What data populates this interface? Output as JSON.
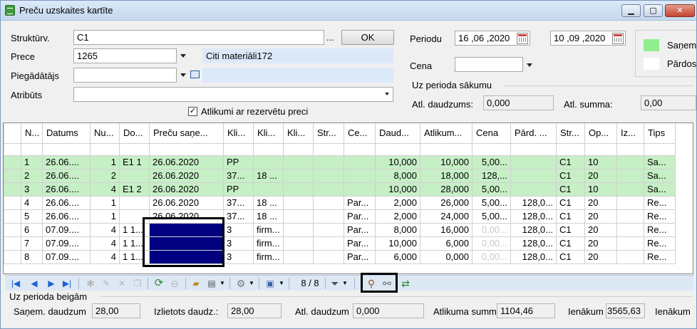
{
  "window": {
    "title": "Preču uzskaites kartīte"
  },
  "form": {
    "struktur_label": "Struktūrv.",
    "struktur_value": "C1",
    "ellipsis": "...",
    "ok_label": "OK",
    "prece_label": "Prece",
    "prece_value": "1265",
    "prece_name": "Citi materiāli172",
    "piegadatajs_label": "Piegādātājs",
    "piegadatajs_value": "",
    "atributs_label": "Atribūts",
    "atributs_value": "",
    "checkbox_label": "Atlikumi ar rezervētu preci",
    "checkbox_checked": true
  },
  "period": {
    "label": "Periodu",
    "from": "16 ,06 ,2020",
    "to": "10 ,09 ,2020",
    "cena_label": "Cena",
    "cena_value": ""
  },
  "start_period": {
    "title": "Uz perioda sākumu",
    "atl_daudzums_label": "Atl. daudzums:",
    "atl_daudzums_value": "0,000",
    "atl_summa_label": "Atl. summa:",
    "atl_summa_value": "0,00"
  },
  "legend": {
    "items": [
      {
        "label": "Saņem",
        "color": "#90ee90"
      },
      {
        "label": "Pārdos",
        "color": "#ffffff"
      }
    ]
  },
  "grid": {
    "columns": [
      "N...",
      "Datums",
      "Nu...",
      "Do...",
      "Preču saņe...",
      "Kli...",
      "Kli...",
      "Kli...",
      "Str...",
      "Ce...",
      "Daud...",
      "Atlikum...",
      "Cena",
      "Pārd. ...",
      "Str...",
      "Op...",
      "Iz...",
      "Tips"
    ],
    "rows": [
      {
        "style": "green",
        "cells": [
          "1",
          "26.06....",
          "1",
          "E1 1",
          "26.06.2020",
          "PP",
          "",
          "",
          "",
          "",
          "10,000",
          "10,000",
          "5,00...",
          "",
          "C1",
          "10",
          "",
          "Sa..."
        ]
      },
      {
        "style": "green",
        "cells": [
          "2",
          "26.06....",
          "2",
          "",
          "26.06.2020",
          "37...",
          "18 ...",
          "",
          "",
          "",
          "8,000",
          "18,000",
          "128,...",
          "",
          "C1",
          "20",
          "",
          "Sa..."
        ]
      },
      {
        "style": "green",
        "cells": [
          "3",
          "26.06....",
          "4",
          "E1 2",
          "26.06.2020",
          "PP",
          "",
          "",
          "",
          "",
          "10,000",
          "28,000",
          "5,00...",
          "",
          "C1",
          "10",
          "",
          "Sa..."
        ]
      },
      {
        "style": "white",
        "cells": [
          "4",
          "26.06....",
          "1",
          "",
          "26.06.2020",
          "37...",
          "18 ...",
          "",
          "",
          "Par...",
          "2,000",
          "26,000",
          "5,00...",
          "128,0...",
          "C1",
          "20",
          "",
          "Re..."
        ]
      },
      {
        "style": "white",
        "cells": [
          "5",
          "26.06....",
          "1",
          "",
          "26.06.2020",
          "37...",
          "18 ...",
          "",
          "",
          "Par...",
          "2,000",
          "24,000",
          "5,00...",
          "128,0...",
          "C1",
          "20",
          "",
          "Re..."
        ]
      },
      {
        "style": "white",
        "cells": [
          "6",
          "07.09....",
          "4",
          "1 1...",
          "",
          "3",
          "firm...",
          "",
          "",
          "Par...",
          "8,000",
          "16,000",
          "0,00...",
          "128,0...",
          "C1",
          "20",
          "",
          "Re..."
        ]
      },
      {
        "style": "white",
        "cells": [
          "7",
          "07.09....",
          "4",
          "1 1...",
          "",
          "3",
          "firm...",
          "",
          "",
          "Par...",
          "10,000",
          "6,000",
          "0,00...",
          "128,0...",
          "C1",
          "20",
          "",
          "Re..."
        ]
      },
      {
        "style": "white",
        "cells": [
          "8",
          "07.09....",
          "4",
          "1 1...",
          "",
          "3",
          "firm...",
          "",
          "",
          "Par...",
          "6,000",
          "0,000",
          "0,00...",
          "128,0...",
          "C1",
          "20",
          "",
          "Re..."
        ]
      }
    ]
  },
  "toolbar": {
    "record_count": "8 / 8",
    "icons": [
      "first-icon",
      "prev-icon",
      "next-icon",
      "last-icon",
      "add-icon",
      "edit-icon",
      "delete-icon",
      "copy-icon",
      "refresh-icon",
      "cancel-icon",
      "open-icon",
      "print-icon",
      "settings-icon",
      "save-icon",
      "filter-icon",
      "link-icon",
      "unlink-icon",
      "transfer-icon"
    ]
  },
  "end_period": {
    "title": "Uz perioda beigām",
    "sanem_label": "Saņem. daudzum",
    "sanem_value": "28,00",
    "izlietots_label": "Izlietots daudz.:",
    "izlietots_value": "28,00",
    "atl_daudzum_label": "Atl. daudzum",
    "atl_daudzum_value": "0,000",
    "atlikuma_summ_label": "Atlikuma summ",
    "atlikuma_summ_value": "1104,46",
    "ienakum_label": "Ienākum",
    "ienakum_value": "3565,63",
    "ienakum2_label": "Ienākum"
  }
}
